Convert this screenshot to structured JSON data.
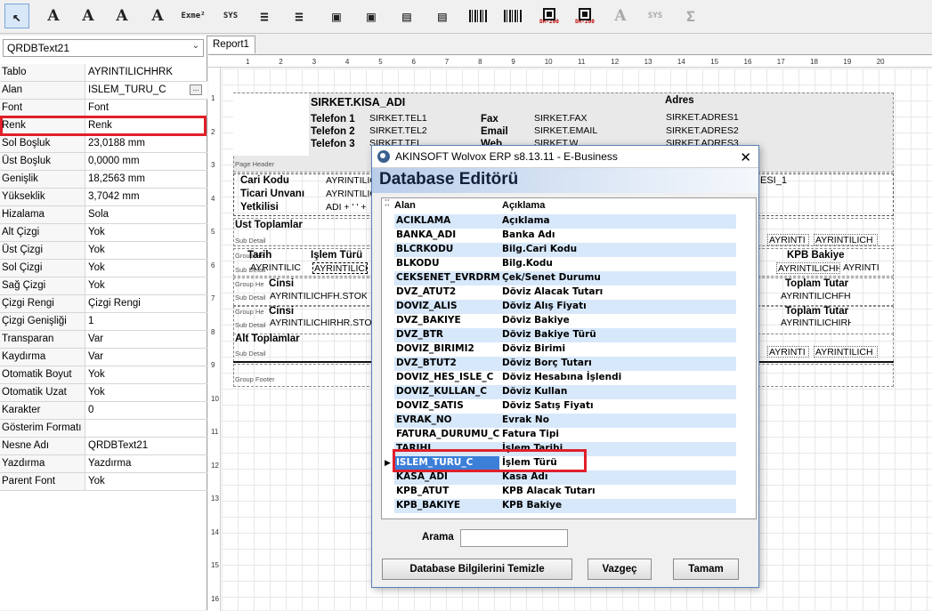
{
  "toolbar": {
    "buttons": [
      {
        "name": "select-arrow-icon",
        "glyph": "↖"
      },
      {
        "name": "text-tool-icon",
        "glyph": "A"
      },
      {
        "name": "db-text-tool-icon",
        "glyph": "A"
      },
      {
        "name": "rich-text-tool-icon",
        "glyph": "A"
      },
      {
        "name": "db-rich-text-tool-icon",
        "glyph": "A"
      },
      {
        "name": "expression-tool-icon",
        "glyph": "Exme²"
      },
      {
        "name": "sysdata-tool-icon",
        "glyph": "SYS"
      },
      {
        "name": "memo-tool-icon",
        "glyph": "≡"
      },
      {
        "name": "db-memo-tool-icon",
        "glyph": "≡"
      },
      {
        "name": "image-tool-icon",
        "glyph": "▣"
      },
      {
        "name": "db-image-tool-icon",
        "glyph": "▣"
      },
      {
        "name": "chart-tool-icon",
        "glyph": "▤"
      },
      {
        "name": "db-chart-tool-icon",
        "glyph": "▤"
      },
      {
        "name": "barcode-tool-icon",
        "glyph": "|||"
      },
      {
        "name": "db-barcode-tool-icon",
        "glyph": "|||"
      },
      {
        "name": "datamatrix-tool-icon",
        "glyph": "DM-200"
      },
      {
        "name": "db-datamatrix-tool-icon",
        "glyph": "DM-200"
      },
      {
        "name": "disabled-text-icon",
        "glyph": "A"
      },
      {
        "name": "disabled-sysdata-icon",
        "glyph": "SYS"
      },
      {
        "name": "disabled-sum-icon",
        "glyph": "Σ"
      }
    ]
  },
  "left": {
    "combo_value": "QRDBText21",
    "properties": [
      {
        "key": "Tablo",
        "value": "AYRINTILICHHRK"
      },
      {
        "key": "Alan",
        "value": "ISLEM_TURU_C"
      },
      {
        "key": "Font",
        "value": "Font"
      },
      {
        "key": "Renk",
        "value": "Renk"
      },
      {
        "key": "Sol Boşluk",
        "value": "23,0188 mm"
      },
      {
        "key": "Üst Boşluk",
        "value": "0,0000 mm"
      },
      {
        "key": "Genişlik",
        "value": "18,2563 mm"
      },
      {
        "key": "Yükseklik",
        "value": "3,7042 mm"
      },
      {
        "key": "Hizalama",
        "value": "Sola"
      },
      {
        "key": "Alt Çizgi",
        "value": "Yok"
      },
      {
        "key": "Üst Çizgi",
        "value": "Yok"
      },
      {
        "key": "Sol Çizgi",
        "value": "Yok"
      },
      {
        "key": "Sağ Çizgi",
        "value": "Yok"
      },
      {
        "key": "Çizgi Rengi",
        "value": "Çizgi Rengi"
      },
      {
        "key": "Çizgi Genişliği",
        "value": "1"
      },
      {
        "key": "Transparan",
        "value": "Var"
      },
      {
        "key": "Kaydırma",
        "value": "Var"
      },
      {
        "key": "Otomatik Boyut",
        "value": "Yok"
      },
      {
        "key": "Otomatik Uzat",
        "value": "Yok"
      },
      {
        "key": "Karakter",
        "value": "0"
      },
      {
        "key": "Gösterim Formatı",
        "value": ""
      },
      {
        "key": "Nesne Adı",
        "value": "QRDBText21"
      },
      {
        "key": "Yazdırma",
        "value": "Yazdırma"
      },
      {
        "key": "Parent Font",
        "value": "Yok"
      }
    ]
  },
  "report": {
    "tab": "Report1",
    "hruler": [
      "1",
      "2",
      "3",
      "4",
      "5",
      "6",
      "7",
      "8",
      "9",
      "10",
      "11",
      "12",
      "13",
      "14",
      "15",
      "16",
      "17",
      "18",
      "19",
      "20"
    ],
    "vruler": [
      "1",
      "2",
      "3",
      "4",
      "5",
      "6",
      "7",
      "8",
      "9",
      "10",
      "11",
      "12",
      "13",
      "14",
      "15",
      "16"
    ],
    "header": {
      "company": "SIRKET.KISA_ADI",
      "tel1_lbl": "Telefon 1",
      "tel2_lbl": "Telefon 2",
      "tel3_lbl": "Telefon 3",
      "tel1": "SIRKET.TEL1",
      "tel2": "SIRKET.TEL2",
      "tel3": "SIRKET.TEL3",
      "fax_lbl": "Fax",
      "email_lbl": "Email",
      "web_lbl": "Web",
      "fax": "SIRKET.FAX",
      "email": "SIRKET.EMAIL",
      "web": "SIRKET.WEB",
      "adres_lbl": "Adres",
      "adres1": "SIRKET.ADRES1",
      "adres2": "SIRKET.ADRES2",
      "adres3": "SIRKET.ADRES3",
      "band_label": "Page Header"
    },
    "cari": {
      "kod_lbl": "Cari Kodu",
      "unvan_lbl": "Ticari Unvanı",
      "yetkili_lbl": "Yetkilisi",
      "kod_val": "AYRINTILIC",
      "unvan_val": "AYRINTILIC",
      "yetkili_val": "ADI + ' ' +",
      "right_val": "ESI_1"
    },
    "ust_toplam": "Üst Toplamlar",
    "sub_detail": "Sub Detail",
    "group_header": "Group He",
    "group_footer": "Group Footer",
    "tarih_lbl": "Tarih",
    "islem_lbl": "İşlem Türü",
    "tarih_val": "AYRINTILIC",
    "islem_val": "AYRINTILICH",
    "cinsi_lbl": "Cinsi",
    "stok_val": "AYRINTILICHFH.STOK_",
    "hizmet_val": "AYRINTILICHIRHR.STOK",
    "alt_toplam": "Alt Toplamlar",
    "kpb_bakiye_lbl": "KPB Bakiye",
    "toplam_tutar_lbl": "Toplam Tutar",
    "r_val1": "AYRINTI",
    "r_val2": "AYRINTILICH",
    "r_val3": "AYRINTILICHH",
    "r_val4": "AYRINTI",
    "r_val5": "AYRINTILICHFH",
    "r_val6": "AYRINTILICHIRH"
  },
  "dialog": {
    "title": "AKINSOFT Wolvox ERP s8.13.11 - E-Business",
    "heading": "Database Editörü",
    "col1": "Alan",
    "col2": "Açıklama",
    "rows": [
      {
        "alan": "ACIKLAMA",
        "aciklama": "Açıklama",
        "sel": false
      },
      {
        "alan": "BANKA_ADI",
        "aciklama": "Banka Adı",
        "sel": false
      },
      {
        "alan": "BLCRKODU",
        "aciklama": "Bilg.Cari Kodu",
        "sel": false
      },
      {
        "alan": "BLKODU",
        "aciklama": "Bilg.Kodu",
        "sel": false
      },
      {
        "alan": "CEKSENET_EVRDRM",
        "aciklama": "Çek/Senet Durumu",
        "sel": false
      },
      {
        "alan": "DVZ_ATUT2",
        "aciklama": "Döviz Alacak Tutarı",
        "sel": false
      },
      {
        "alan": "DOVIZ_ALIS",
        "aciklama": "Döviz Alış Fiyatı",
        "sel": false
      },
      {
        "alan": "DVZ_BAKIYE",
        "aciklama": "Döviz Bakiye",
        "sel": false
      },
      {
        "alan": "DVZ_BTR",
        "aciklama": "Döviz Bakiye Türü",
        "sel": false
      },
      {
        "alan": "DOVIZ_BIRIMI2",
        "aciklama": "Döviz Birimi",
        "sel": false
      },
      {
        "alan": "DVZ_BTUT2",
        "aciklama": "Döviz Borç Tutarı",
        "sel": false
      },
      {
        "alan": "DOVIZ_HES_ISLE_C",
        "aciklama": "Döviz Hesabına İşlendi",
        "sel": false
      },
      {
        "alan": "DOVIZ_KULLAN_C",
        "aciklama": "Döviz Kullan",
        "sel": false
      },
      {
        "alan": "DOVIZ_SATIS",
        "aciklama": "Döviz Satış Fiyatı",
        "sel": false
      },
      {
        "alan": "EVRAK_NO",
        "aciklama": "Evrak No",
        "sel": false
      },
      {
        "alan": "FATURA_DURUMU_C",
        "aciklama": "Fatura Tipi",
        "sel": false
      },
      {
        "alan": "TARIHI",
        "aciklama": "İşlem Tarihi",
        "sel": false
      },
      {
        "alan": "ISLEM_TURU_C",
        "aciklama": "İşlem Türü",
        "sel": true
      },
      {
        "alan": "KASA_ADI",
        "aciklama": "Kasa Adı",
        "sel": false
      },
      {
        "alan": "KPB_ATUT",
        "aciklama": "KPB Alacak Tutarı",
        "sel": false
      },
      {
        "alan": "KPB_BAKIYE",
        "aciklama": "KPB Bakiye",
        "sel": false
      }
    ],
    "search_label": "Arama",
    "search_value": "",
    "btn_clear": "Database Bilgilerini Temizle",
    "btn_cancel": "Vazgeç",
    "btn_ok": "Tamam",
    "row_color_a": "#ffffff",
    "row_color_b": "#d7e8fb"
  }
}
